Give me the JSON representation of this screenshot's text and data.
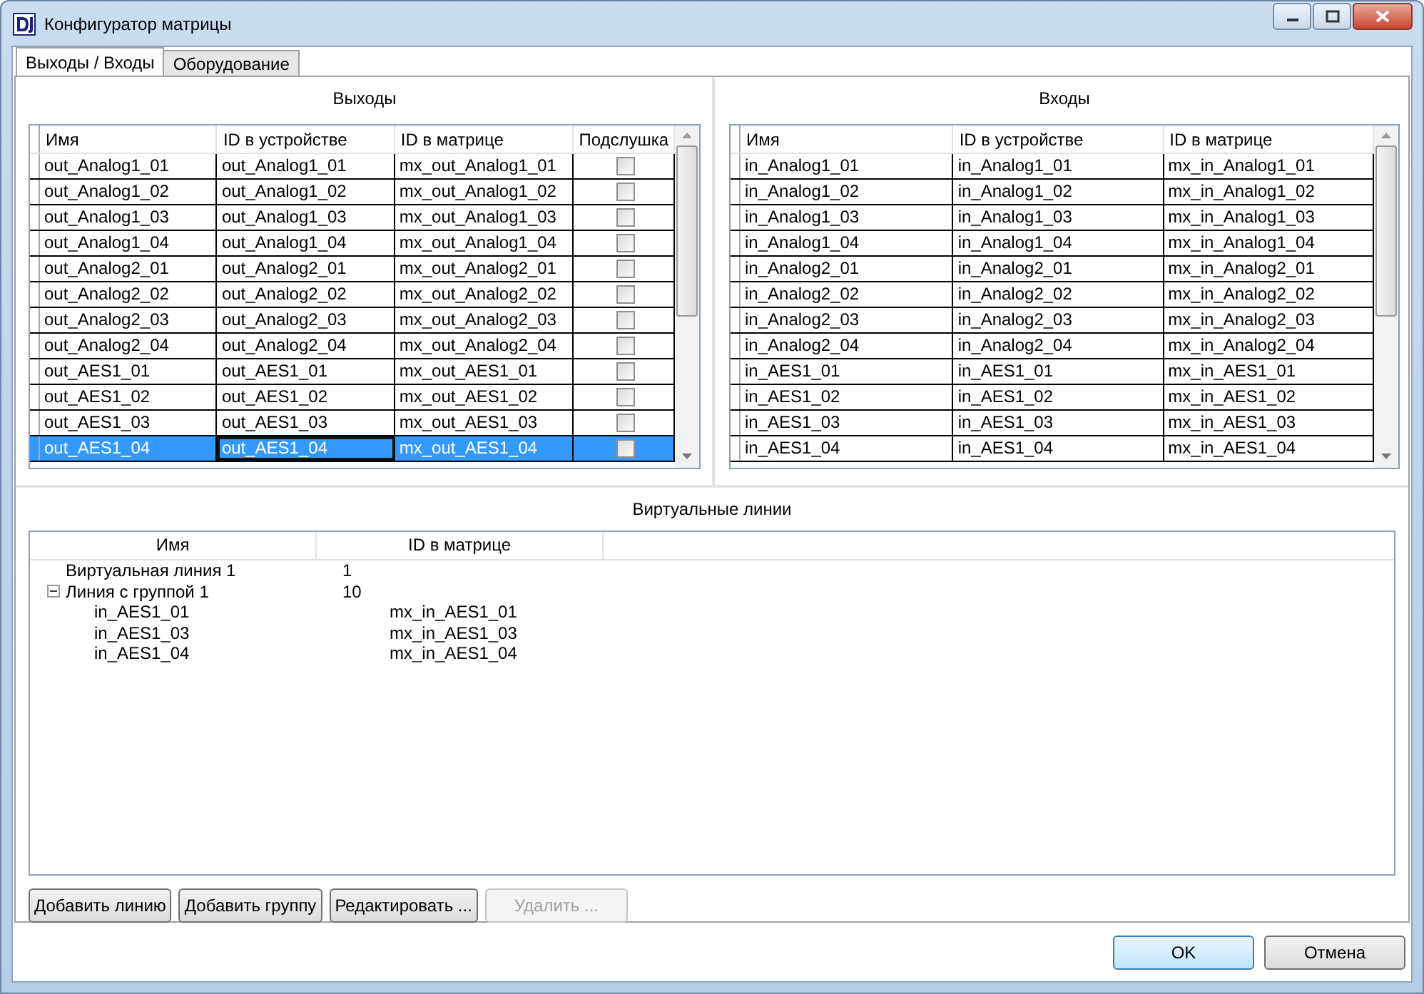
{
  "window": {
    "title": "Конфигуратор матрицы"
  },
  "tabs": [
    {
      "label": "Выходы / Входы",
      "selected": true
    },
    {
      "label": "Оборудование",
      "selected": false
    }
  ],
  "outputs": {
    "title": "Выходы",
    "columns": [
      "Имя",
      "ID в устройстве",
      "ID в матрице",
      "Подслушка"
    ],
    "rows": [
      {
        "name": "out_Analog1_01",
        "device_id": "out_Analog1_01",
        "matrix_id": "mx_out_Analog1_01",
        "monitor": false,
        "selected": false
      },
      {
        "name": "out_Analog1_02",
        "device_id": "out_Analog1_02",
        "matrix_id": "mx_out_Analog1_02",
        "monitor": false,
        "selected": false
      },
      {
        "name": "out_Analog1_03",
        "device_id": "out_Analog1_03",
        "matrix_id": "mx_out_Analog1_03",
        "monitor": false,
        "selected": false
      },
      {
        "name": "out_Analog1_04",
        "device_id": "out_Analog1_04",
        "matrix_id": "mx_out_Analog1_04",
        "monitor": false,
        "selected": false
      },
      {
        "name": "out_Analog2_01",
        "device_id": "out_Analog2_01",
        "matrix_id": "mx_out_Analog2_01",
        "monitor": false,
        "selected": false
      },
      {
        "name": "out_Analog2_02",
        "device_id": "out_Analog2_02",
        "matrix_id": "mx_out_Analog2_02",
        "monitor": false,
        "selected": false
      },
      {
        "name": "out_Analog2_03",
        "device_id": "out_Analog2_03",
        "matrix_id": "mx_out_Analog2_03",
        "monitor": false,
        "selected": false
      },
      {
        "name": "out_Analog2_04",
        "device_id": "out_Analog2_04",
        "matrix_id": "mx_out_Analog2_04",
        "monitor": false,
        "selected": false
      },
      {
        "name": "out_AES1_01",
        "device_id": "out_AES1_01",
        "matrix_id": "mx_out_AES1_01",
        "monitor": false,
        "selected": false
      },
      {
        "name": "out_AES1_02",
        "device_id": "out_AES1_02",
        "matrix_id": "mx_out_AES1_02",
        "monitor": false,
        "selected": false
      },
      {
        "name": "out_AES1_03",
        "device_id": "out_AES1_03",
        "matrix_id": "mx_out_AES1_03",
        "monitor": false,
        "selected": false
      },
      {
        "name": "out_AES1_04",
        "device_id": "out_AES1_04",
        "matrix_id": "mx_out_AES1_04",
        "monitor": false,
        "selected": true
      }
    ]
  },
  "inputs": {
    "title": "Входы",
    "columns": [
      "Имя",
      "ID в устройстве",
      "ID в матрице"
    ],
    "rows": [
      {
        "name": "in_Analog1_01",
        "device_id": "in_Analog1_01",
        "matrix_id": "mx_in_Analog1_01"
      },
      {
        "name": "in_Analog1_02",
        "device_id": "in_Analog1_02",
        "matrix_id": "mx_in_Analog1_02"
      },
      {
        "name": "in_Analog1_03",
        "device_id": "in_Analog1_03",
        "matrix_id": "mx_in_Analog1_03"
      },
      {
        "name": "in_Analog1_04",
        "device_id": "in_Analog1_04",
        "matrix_id": "mx_in_Analog1_04"
      },
      {
        "name": "in_Analog2_01",
        "device_id": "in_Analog2_01",
        "matrix_id": "mx_in_Analog2_01"
      },
      {
        "name": "in_Analog2_02",
        "device_id": "in_Analog2_02",
        "matrix_id": "mx_in_Analog2_02"
      },
      {
        "name": "in_Analog2_03",
        "device_id": "in_Analog2_03",
        "matrix_id": "mx_in_Analog2_03"
      },
      {
        "name": "in_Analog2_04",
        "device_id": "in_Analog2_04",
        "matrix_id": "mx_in_Analog2_04"
      },
      {
        "name": "in_AES1_01",
        "device_id": "in_AES1_01",
        "matrix_id": "mx_in_AES1_01"
      },
      {
        "name": "in_AES1_02",
        "device_id": "in_AES1_02",
        "matrix_id": "mx_in_AES1_02"
      },
      {
        "name": "in_AES1_03",
        "device_id": "in_AES1_03",
        "matrix_id": "mx_in_AES1_03"
      },
      {
        "name": "in_AES1_04",
        "device_id": "in_AES1_04",
        "matrix_id": "mx_in_AES1_04"
      }
    ]
  },
  "virtual_lines": {
    "title": "Виртуальные линии",
    "columns": [
      "Имя",
      "ID в матрице"
    ],
    "items": [
      {
        "name": "Виртуальная линия 1",
        "matrix_id": "1"
      },
      {
        "name": "Линия с группой 1",
        "matrix_id": "10",
        "expanded": true,
        "children": [
          {
            "name": "in_AES1_01",
            "matrix_id": "mx_in_AES1_01"
          },
          {
            "name": "in_AES1_03",
            "matrix_id": "mx_in_AES1_03"
          },
          {
            "name": "in_AES1_04",
            "matrix_id": "mx_in_AES1_04"
          }
        ]
      }
    ]
  },
  "line_buttons": [
    {
      "label": "Добавить линию",
      "disabled": false
    },
    {
      "label": "Добавить группу",
      "disabled": false
    },
    {
      "label": "Редактировать ...",
      "disabled": false
    },
    {
      "label": "Удалить ...",
      "disabled": true
    }
  ],
  "dialog_buttons": [
    {
      "label": "OK",
      "default": true
    },
    {
      "label": "Отмена",
      "default": false
    }
  ]
}
